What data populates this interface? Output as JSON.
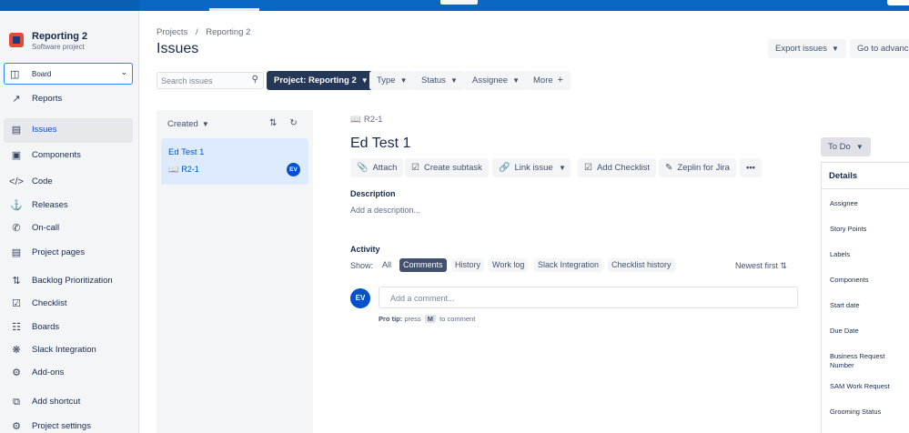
{
  "project": {
    "name": "Reporting 2",
    "type": "Software project"
  },
  "board_select": {
    "label": "Board"
  },
  "sidebar": {
    "items": [
      {
        "label": "Reports",
        "icon": "chart-line-icon"
      },
      {
        "label": "Issues",
        "icon": "issues-icon",
        "active": true
      },
      {
        "label": "Components",
        "icon": "components-icon"
      },
      {
        "label": "Code",
        "icon": "code-icon"
      },
      {
        "label": "Releases",
        "icon": "ship-icon"
      },
      {
        "label": "On-call",
        "icon": "phone-icon"
      },
      {
        "label": "Project pages",
        "icon": "page-icon"
      },
      {
        "label": "Backlog Prioritization",
        "icon": "sort-icon"
      },
      {
        "label": "Checklist",
        "icon": "checkbox-icon"
      },
      {
        "label": "Boards",
        "icon": "boards-icon"
      },
      {
        "label": "Slack Integration",
        "icon": "slack-icon"
      },
      {
        "label": "Add-ons",
        "icon": "gear-icon"
      },
      {
        "label": "Add shortcut",
        "icon": "add-shortcut-icon"
      },
      {
        "label": "Project settings",
        "icon": "settings-icon"
      }
    ]
  },
  "breadcrumb": {
    "projects": "Projects",
    "sep": "/",
    "project": "Reporting 2"
  },
  "page_title": "Issues",
  "header_buttons": {
    "export": "Export issues",
    "advanced": "Go to advance"
  },
  "filters": {
    "search_placeholder": "Search issues",
    "project": "Project: Reporting 2",
    "type": "Type",
    "status": "Status",
    "assignee": "Assignee",
    "more": "More"
  },
  "list": {
    "sort_label": "Created",
    "issues": [
      {
        "title": "Ed Test 1",
        "key": "R2-1",
        "avatar": "EV"
      }
    ]
  },
  "issue": {
    "key": "R2-1",
    "title": "Ed Test 1",
    "actions": {
      "attach": "Attach",
      "subtask": "Create subtask",
      "link": "Link issue",
      "checklist": "Add Checklist",
      "zeplin": "Zeplin for Jira",
      "more": "•••"
    },
    "description_label": "Description",
    "description_placeholder": "Add a description...",
    "status": "To Do"
  },
  "activity": {
    "label": "Activity",
    "show": "Show:",
    "tabs": [
      "All",
      "Comments",
      "History",
      "Work log",
      "Slack Integration",
      "Checklist history"
    ],
    "selected": "Comments",
    "sort": "Newest first",
    "avatar": "EV",
    "comment_placeholder": "Add a comment...",
    "protip_label": "Pro tip:",
    "protip_press": "press",
    "protip_key": "M",
    "protip_rest": "to comment"
  },
  "details": {
    "title": "Details",
    "fields": [
      "Assignee",
      "Story Points",
      "Labels",
      "Components",
      "Start date",
      "Due Date",
      "Business Request Number",
      "SAM Work Request",
      "Grooming Status"
    ]
  }
}
